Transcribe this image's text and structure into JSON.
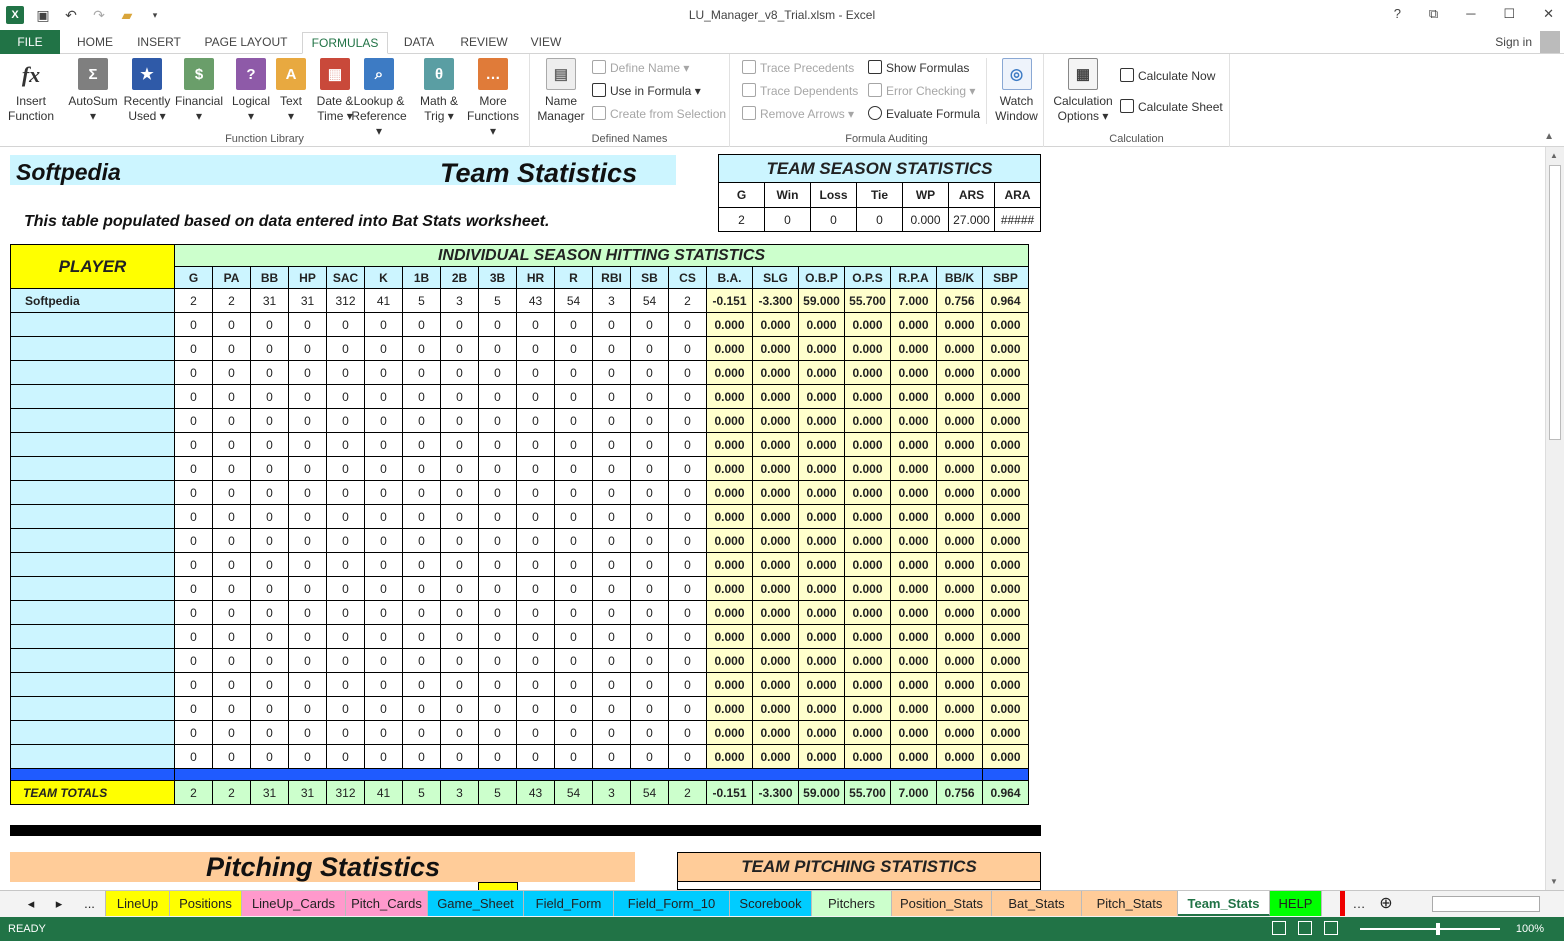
{
  "window": {
    "title": "LU_Manager_v8_Trial.xlsm - Excel",
    "help": "?",
    "restore": "⧉",
    "minimize": "─",
    "maximize": "☐",
    "close": "✕",
    "signin": "Sign in"
  },
  "ribbon_tabs": [
    "FILE",
    "HOME",
    "INSERT",
    "PAGE LAYOUT",
    "FORMULAS",
    "DATA",
    "REVIEW",
    "VIEW"
  ],
  "ribbon": {
    "function_library": {
      "label": "Function Library",
      "insert_function": [
        "Insert",
        "Function"
      ],
      "buttons": [
        {
          "l1": "AutoSum",
          "l2": "▾",
          "color": "#7f7f7f",
          "glyph": "Σ"
        },
        {
          "l1": "Recently",
          "l2": "Used ▾",
          "color": "#2f5aa8",
          "glyph": "★"
        },
        {
          "l1": "Financial",
          "l2": "▾",
          "color": "#6a9e6a",
          "glyph": "$"
        },
        {
          "l1": "Logical",
          "l2": "▾",
          "color": "#8e5aa8",
          "glyph": "?"
        },
        {
          "l1": "Text",
          "l2": "▾",
          "color": "#e8a940",
          "glyph": "A"
        },
        {
          "l1": "Date &",
          "l2": "Time ▾",
          "color": "#c9493a",
          "glyph": "▦"
        },
        {
          "l1": "Lookup &",
          "l2": "Reference ▾",
          "color": "#3d7bc4",
          "glyph": "⌕"
        },
        {
          "l1": "Math &",
          "l2": "Trig ▾",
          "color": "#5a9ea3",
          "glyph": "θ"
        },
        {
          "l1": "More",
          "l2": "Functions ▾",
          "color": "#e07b39",
          "glyph": "…"
        }
      ]
    },
    "defined_names": {
      "label": "Defined Names",
      "name_manager": [
        "Name",
        "Manager"
      ],
      "define_name": "Define Name ▾",
      "use_in_formula": "Use in Formula ▾",
      "create_from_selection": "Create from Selection"
    },
    "formula_auditing": {
      "label": "Formula Auditing",
      "trace_precedents": "Trace Precedents",
      "trace_dependents": "Trace Dependents",
      "remove_arrows": "Remove Arrows ▾",
      "show_formulas": "Show Formulas",
      "error_checking": "Error Checking ▾",
      "evaluate_formula": "Evaluate Formula",
      "watch_window": [
        "Watch",
        "Window"
      ]
    },
    "calculation": {
      "label": "Calculation",
      "calc_options": [
        "Calculation",
        "Options ▾"
      ],
      "calc_now": "Calculate Now",
      "calc_sheet": "Calculate Sheet"
    }
  },
  "sheet": {
    "title_left": "Softpedia",
    "title_center": "Team Statistics",
    "note": "This table populated based on data entered into Bat Stats worksheet.",
    "team_season": {
      "caption": "TEAM SEASON STATISTICS",
      "headers": [
        "G",
        "Win",
        "Loss",
        "Tie",
        "WP",
        "ARS",
        "ARA"
      ],
      "values": [
        "2",
        "0",
        "0",
        "0",
        "0.000",
        "27.000",
        "#####"
      ]
    },
    "hitting": {
      "player_header": "PLAYER",
      "caption": "INDIVIDUAL SEASON HITTING STATISTICS",
      "headers": [
        "G",
        "PA",
        "BB",
        "HP",
        "SAC",
        "K",
        "1B",
        "2B",
        "3B",
        "HR",
        "R",
        "RBI",
        "SB",
        "CS",
        "B.A.",
        "SLG",
        "O.B.P",
        "O.P.S",
        "R.P.A",
        "BB/K",
        "SBP"
      ],
      "rows": [
        {
          "name": "Softpedia",
          "counts": [
            "2",
            "2",
            "31",
            "31",
            "312",
            "41",
            "5",
            "3",
            "5",
            "43",
            "54",
            "3",
            "54",
            "2"
          ],
          "rates": [
            "-0.151",
            "-3.300",
            "59.000",
            "55.700",
            "7.000",
            "0.756",
            "0.964"
          ]
        }
      ],
      "zero_counts": [
        "0",
        "0",
        "0",
        "0",
        "0",
        "0",
        "0",
        "0",
        "0",
        "0",
        "0",
        "0",
        "0",
        "0"
      ],
      "zero_rates": [
        "0.000",
        "0.000",
        "0.000",
        "0.000",
        "0.000",
        "0.000",
        "0.000"
      ],
      "empty_rows": 19,
      "totals": {
        "label": "TEAM TOTALS",
        "counts": [
          "2",
          "2",
          "31",
          "31",
          "312",
          "41",
          "5",
          "3",
          "5",
          "43",
          "54",
          "3",
          "54",
          "2"
        ],
        "rates": [
          "-0.151",
          "-3.300",
          "59.000",
          "55.700",
          "7.000",
          "0.756",
          "0.964"
        ]
      }
    },
    "pitching_title": "Pitching Statistics",
    "team_pitching_caption": "TEAM PITCHING STATISTICS"
  },
  "sheet_tabs": [
    {
      "name": "...",
      "color": "#f3f3f3"
    },
    {
      "name": "LineUp",
      "color": "#ffff00"
    },
    {
      "name": "Positions",
      "color": "#ffff00"
    },
    {
      "name": "LineUp_Cards",
      "color": "#ff99cc"
    },
    {
      "name": "Pitch_Cards",
      "color": "#ff99cc"
    },
    {
      "name": "Game_Sheet",
      "color": "#00ccff"
    },
    {
      "name": "Field_Form",
      "color": "#00ccff"
    },
    {
      "name": "Field_Form_10",
      "color": "#00ccff"
    },
    {
      "name": "Scorebook",
      "color": "#00ccff"
    },
    {
      "name": "Pitchers",
      "color": "#ccffcc"
    },
    {
      "name": "Position_Stats",
      "color": "#ffcc99"
    },
    {
      "name": "Bat_Stats",
      "color": "#ffcc99"
    },
    {
      "name": "Pitch_Stats",
      "color": "#ffcc99"
    },
    {
      "name": "Team_Stats",
      "color": "#ffffff"
    },
    {
      "name": "HELP",
      "color": "#00ff00"
    }
  ],
  "status": {
    "text": "READY",
    "zoom": "100%"
  }
}
